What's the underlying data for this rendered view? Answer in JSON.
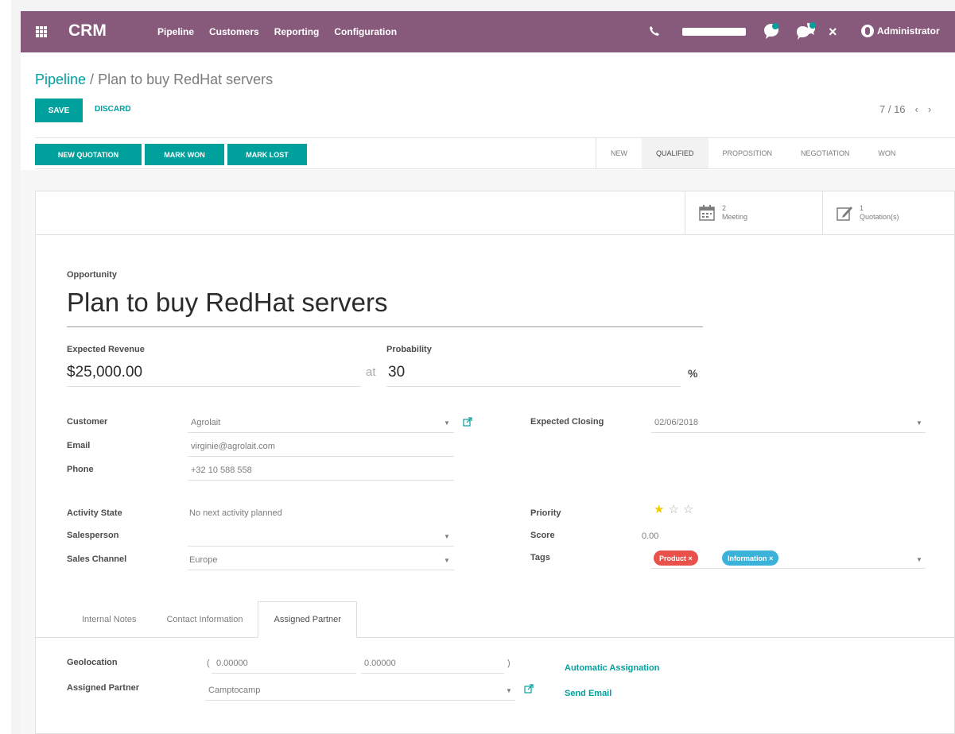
{
  "navbar": {
    "app_name": "CRM",
    "menu": [
      "Pipeline",
      "Customers",
      "Reporting",
      "Configuration"
    ],
    "user": "Administrator",
    "close_symbol": "×",
    "icons": [
      "apps-grid-icon",
      "phone-icon",
      "chat-bubble-icon",
      "chat-bubbles-icon",
      "close-icon",
      "avatar"
    ],
    "color": "#875a7b"
  },
  "breadcrumb": {
    "parent": "Pipeline",
    "separator": " / ",
    "current": "Plan to buy RedHat servers"
  },
  "actions": {
    "save": "SAVE",
    "discard": "DISCARD"
  },
  "pager": {
    "value": "7 / 16",
    "prev": "‹",
    "next": "›"
  },
  "header_buttons": [
    "NEW QUOTATION",
    "MARK WON",
    "MARK LOST"
  ],
  "stages": [
    "NEW",
    "QUALIFIED",
    "PROPOSITION",
    "NEGOTIATION",
    "WON"
  ],
  "active_stage": "QUALIFIED",
  "smart_buttons": {
    "meeting": {
      "count": "2",
      "label": "Meeting"
    },
    "quotation": {
      "count": "1",
      "label": "Quotation(s)"
    }
  },
  "form": {
    "opportunity_label": "Opportunity",
    "opportunity_name": "Plan to buy RedHat servers",
    "expected_revenue_label": "Expected Revenue",
    "expected_revenue": "$25,000.00",
    "at_text": "at",
    "probability_label": "Probability",
    "probability": "30",
    "percent_sign": "%",
    "customer_label": "Customer",
    "customer": "Agrolait",
    "email_label": "Email",
    "email": "virginie@agrolait.com",
    "phone_label": "Phone",
    "phone": "+32 10 588 558",
    "expected_closing_label": "Expected Closing",
    "expected_closing": "02/06/2018",
    "activity_state_label": "Activity State",
    "activity_state": "No next activity planned",
    "salesperson_label": "Salesperson",
    "salesperson": "",
    "sales_channel_label": "Sales Channel",
    "sales_channel": "Europe",
    "priority_label": "Priority",
    "priority_stars": 1,
    "priority_max": 3,
    "score_label": "Score",
    "score": "0.00",
    "tags_label": "Tags",
    "tags": [
      {
        "label": "Product ×",
        "color": "#e9524a"
      },
      {
        "label": "Information ×",
        "color": "#3bb2da"
      }
    ]
  },
  "tabs": [
    "Internal Notes",
    "Contact Information",
    "Assigned Partner"
  ],
  "active_tab": "Assigned Partner",
  "partner_tab": {
    "geolocation_label": "Geolocation",
    "latitude": "0.00000",
    "longitude": "0.00000",
    "open_paren": "(",
    "close_paren": ")",
    "assigned_partner_label": "Assigned Partner",
    "assigned_partner": "Camptocamp",
    "automatic_assignation": "Automatic Assignation",
    "send_email": "Send Email"
  },
  "colors": {
    "accent": "#00a09d",
    "brand": "#875a7b",
    "star": "#f3cc00"
  }
}
